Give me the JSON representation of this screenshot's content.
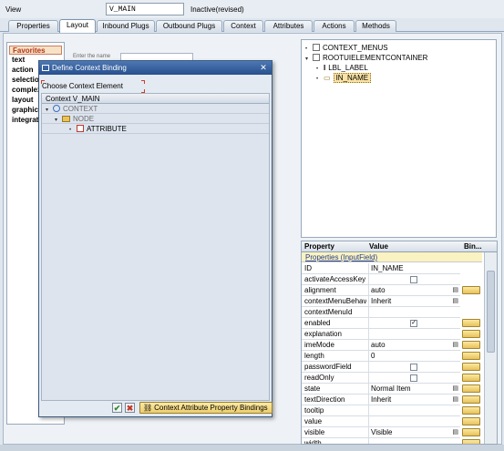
{
  "view": {
    "label": "View",
    "name": "V_MAIN",
    "status": "Inactive(revised)"
  },
  "tabs": [
    "Properties",
    "Layout",
    "Inbound Plugs",
    "Outbound Plugs",
    "Context",
    "Attributes",
    "Actions",
    "Methods"
  ],
  "active_tab": "Layout",
  "palette": [
    "Favorites",
    "text",
    "action",
    "selection",
    "complex",
    "layout",
    "graphic",
    "integration"
  ],
  "designer": {
    "enter_name_hint": "Enter the name"
  },
  "ui_tree": {
    "items": [
      {
        "label": "CONTEXT_MENUS"
      },
      {
        "label": "ROOTUIELEMENTCONTAINER"
      },
      {
        "label": "LBL_LABEL"
      },
      {
        "label": "IN_NAME"
      }
    ]
  },
  "properties": {
    "header": {
      "property": "Property",
      "value": "Value",
      "binding": "Bin..."
    },
    "group": "Properties (InputField)",
    "rows": [
      {
        "name": "ID",
        "value": "IN_NAME",
        "bind": false
      },
      {
        "name": "activateAccessKey",
        "value": "",
        "bind": false,
        "checkbox": "unchecked"
      },
      {
        "name": "alignment",
        "value": "auto",
        "bind": true,
        "dropdown": true
      },
      {
        "name": "contextMenuBehav",
        "value": "Inherit",
        "bind": false,
        "dropdown": true
      },
      {
        "name": "contextMenuId",
        "value": "",
        "bind": false
      },
      {
        "name": "enabled",
        "value": "",
        "bind": true,
        "checkbox": "checked"
      },
      {
        "name": "explanation",
        "value": "",
        "bind": true
      },
      {
        "name": "imeMode",
        "value": "auto",
        "bind": true,
        "dropdown": true
      },
      {
        "name": "length",
        "value": "0",
        "bind": true
      },
      {
        "name": "passwordField",
        "value": "",
        "bind": true,
        "checkbox": "unchecked"
      },
      {
        "name": "readOnly",
        "value": "",
        "bind": true,
        "checkbox": "unchecked"
      },
      {
        "name": "state",
        "value": "Normal Item",
        "bind": true,
        "dropdown": true
      },
      {
        "name": "textDirection",
        "value": "Inherit",
        "bind": true,
        "dropdown": true
      },
      {
        "name": "tooltip",
        "value": "",
        "bind": true
      },
      {
        "name": "value",
        "value": "",
        "bind": true
      },
      {
        "name": "visible",
        "value": "Visible",
        "bind": true,
        "dropdown": true
      },
      {
        "name": "width",
        "value": "",
        "bind": true
      }
    ]
  },
  "dialog": {
    "title": "Define Context Binding",
    "choose_label": "Choose Context Element",
    "tree_header": "Context V_MAIN",
    "tree": [
      {
        "label": "CONTEXT",
        "type": "root"
      },
      {
        "label": "NODE",
        "type": "node"
      },
      {
        "label": "ATTRIBUTE",
        "type": "attribute"
      }
    ],
    "bindings_button": "Context Attribute Property Bindings"
  },
  "colors": {
    "accent": "#27508d",
    "selection": "#f9e2a3",
    "bind_button": "#e8c25b"
  }
}
